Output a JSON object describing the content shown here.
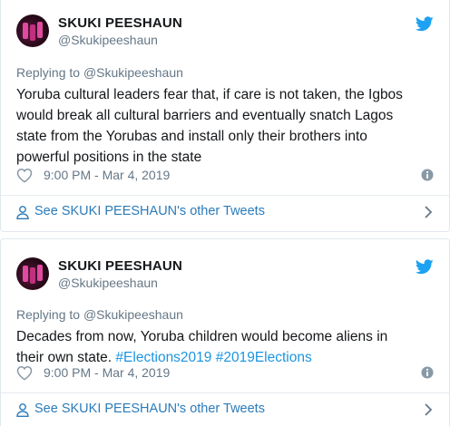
{
  "tweets": [
    {
      "display_name": "SKUKI PEESHAUN",
      "handle": "@Skukipeeshaun",
      "replying_prefix": "Replying to ",
      "replying_handle": "@Skukipeeshaun",
      "text_lines": [
        "Yoruba cultural leaders fear that, if care is not taken, the Igbos",
        "would break all cultural barriers and eventually snatch Lagos",
        "state from the Yorubas and install only their brothers into",
        "powerful positions in the state"
      ],
      "timestamp": "9:00 PM - Mar 4, 2019",
      "footer_link": "See SKUKI PEESHAUN's other Tweets"
    },
    {
      "display_name": "SKUKI PEESHAUN",
      "handle": "@Skukipeeshaun",
      "replying_prefix": "Replying to ",
      "replying_handle": "@Skukipeeshaun",
      "text_line_1": "Decades from now, Yoruba children would become aliens in",
      "text_line_2_plain": "their own state. ",
      "hashtag_1": "#Elections2019",
      "hashtag_2": "#2019Elections",
      "timestamp": "9:00 PM - Mar 4, 2019",
      "footer_link": "See SKUKI PEESHAUN's other Tweets"
    }
  ],
  "colors": {
    "twitter_blue": "#1da1f2",
    "link_blue": "#1b95e0",
    "secondary_text": "#657786",
    "border": "#e1e8ed"
  },
  "icons": [
    "twitter-bird-icon",
    "heart-icon",
    "info-icon",
    "person-icon",
    "chevron-right-icon"
  ]
}
